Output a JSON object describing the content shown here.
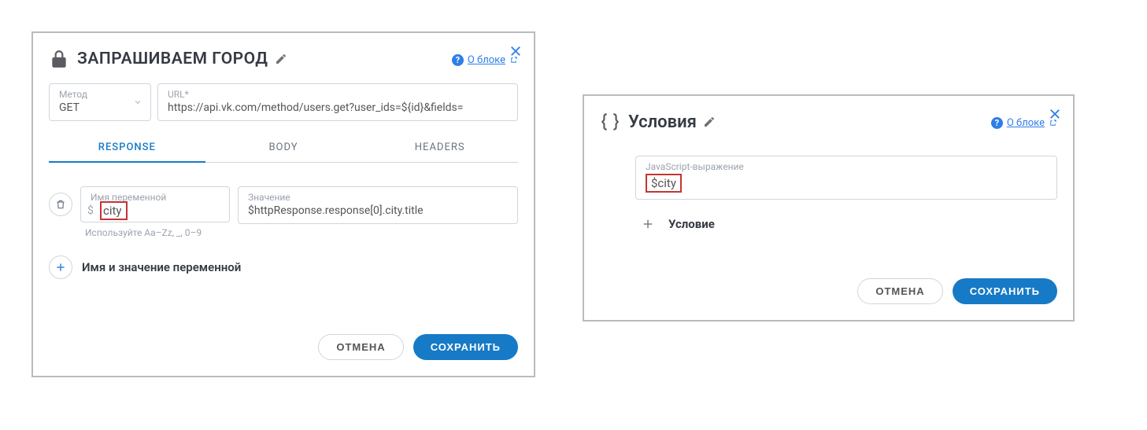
{
  "leftPanel": {
    "title": "ЗАПРАШИВАЕМ ГОРОД",
    "helpLabel": "О блоке",
    "method": {
      "label": "Метод",
      "value": "GET"
    },
    "url": {
      "label": "URL*",
      "value": "https://api.vk.com/method/users.get?user_ids=${id}&fields="
    },
    "tabs": {
      "response": "RESPONSE",
      "body": "BODY",
      "headers": "HEADERS",
      "active": "response"
    },
    "variable": {
      "nameLabel": "Имя переменной",
      "name": "city",
      "valueLabel": "Значение",
      "value": "$httpResponse.response[0].city.title",
      "hint": "Используйте Aa–Zz, _, 0–9"
    },
    "addLabel": "Имя и значение переменной",
    "cancel": "ОТМЕНА",
    "save": "СОХРАНИТЬ"
  },
  "rightPanel": {
    "title": "Условия",
    "helpLabel": "О блоке",
    "jsExpression": {
      "label": "JavaScript-выражение",
      "value": "$city"
    },
    "addConditionLabel": "Условие",
    "cancel": "ОТМЕНА",
    "save": "СОХРАНИТЬ"
  }
}
